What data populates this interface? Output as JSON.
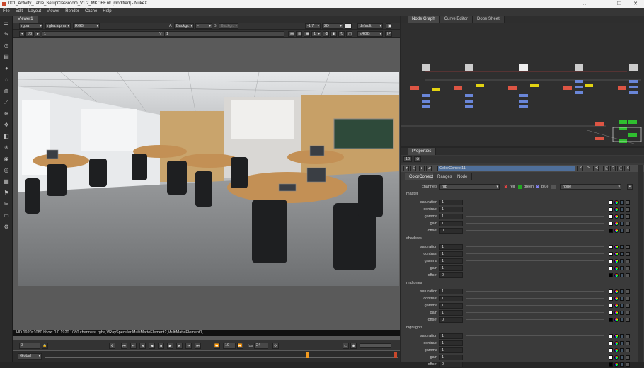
{
  "window": {
    "title": "001_Activity_Table_SetupClassroom_V1.2_MKOFF.nk [modified] - NukeX"
  },
  "menu": [
    "File",
    "Edit",
    "Layout",
    "Viewer",
    "Render",
    "Cache",
    "Help"
  ],
  "viewer": {
    "tab": "Viewer1",
    "channels": "rgba",
    "alpha": "rgba.alpha",
    "colorspace": "RGB",
    "a_label": "A",
    "a_input": "Backgr.",
    "a_dash": "-",
    "b_label": "B",
    "b_input": "Backgr.",
    "gain": "-1.7",
    "mode": "2D",
    "lut": "default",
    "frame_step_label": "f/8",
    "frame_val": "1",
    "y_label": "Y",
    "y_val": "1",
    "srgb": "sRGB",
    "ip": "IP",
    "zoom": "1",
    "info": "HD 1920x1080 bbox: 0 0 1920 1080 channels: rgba,VRaySpecular,MultiMatteElement2,MultiMatteElement1,",
    "current_frame": "3",
    "fps_label": "fps",
    "fps": "24",
    "frame_inc": "10",
    "scope": "Global"
  },
  "panels": {
    "node_graph": "Node Graph",
    "curve_editor": "Curve Editor",
    "dope_sheet": "Dope Sheet",
    "properties": "Properties"
  },
  "properties": {
    "count": "10",
    "node_name": "ColorCorrect11",
    "tabs": [
      "ColorCorrect",
      "Ranges",
      "Node"
    ],
    "channels_label": "channels",
    "channels_val": "rgb",
    "chk": [
      "red",
      "green",
      "blue"
    ],
    "none_val": "none",
    "sections": [
      {
        "name": "master",
        "rows": [
          [
            "saturation",
            "1"
          ],
          [
            "contrast",
            "1"
          ],
          [
            "gamma",
            "1"
          ],
          [
            "gain",
            "1"
          ],
          [
            "offset",
            "0"
          ]
        ]
      },
      {
        "name": "shadows",
        "rows": [
          [
            "saturation",
            "1"
          ],
          [
            "contrast",
            "1"
          ],
          [
            "gamma",
            "1"
          ],
          [
            "gain",
            "1"
          ],
          [
            "offset",
            "0"
          ]
        ]
      },
      {
        "name": "midtones",
        "rows": [
          [
            "saturation",
            "1"
          ],
          [
            "contrast",
            "1"
          ],
          [
            "gamma",
            "1"
          ],
          [
            "gain",
            "1"
          ],
          [
            "offset",
            "0"
          ]
        ]
      },
      {
        "name": "highlights",
        "rows": [
          [
            "saturation",
            "1"
          ],
          [
            "contrast",
            "1"
          ],
          [
            "gamma",
            "1"
          ],
          [
            "gain",
            "1"
          ],
          [
            "offset",
            "0"
          ]
        ]
      }
    ]
  },
  "colors": {
    "accent": "#f39a1e",
    "node_selected": "#f0c419"
  }
}
